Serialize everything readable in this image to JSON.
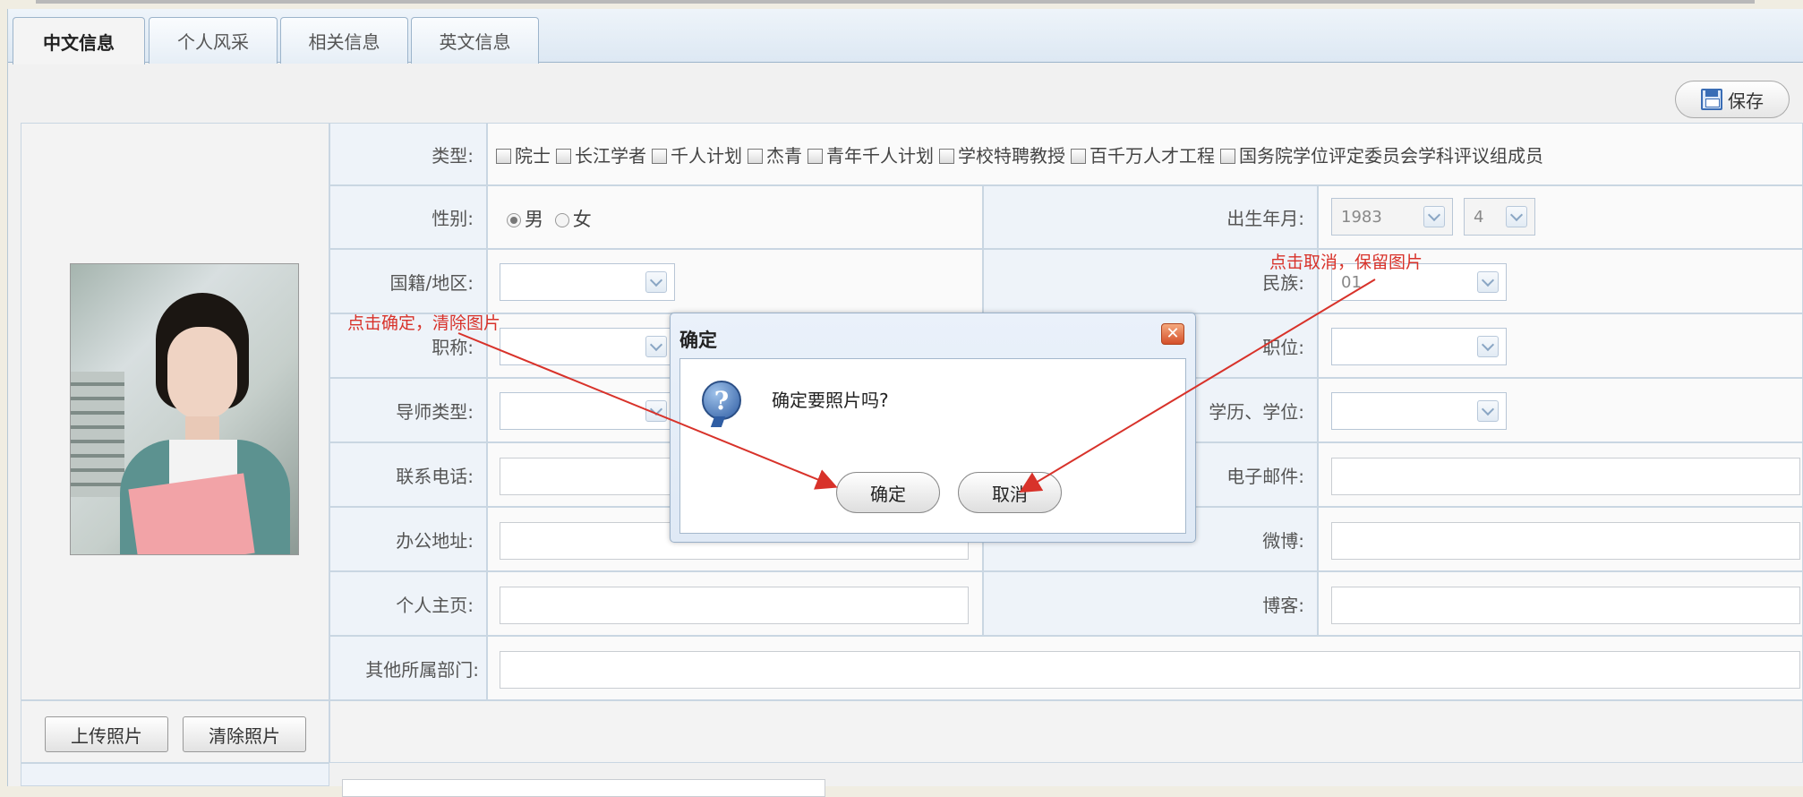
{
  "tabs": [
    {
      "label": "中文信息",
      "active": true
    },
    {
      "label": "个人风采",
      "active": false
    },
    {
      "label": "相关信息",
      "active": false
    },
    {
      "label": "英文信息",
      "active": false
    }
  ],
  "toolbar": {
    "save_label": "保存",
    "save_icon": "floppy-disk-icon"
  },
  "form": {
    "type_label": "类型:",
    "types": [
      "院士",
      "长江学者",
      "千人计划",
      "杰青",
      "青年千人计划",
      "学校特聘教授",
      "百千万人才工程",
      "国务院学位评定委员会学科评议组成员"
    ],
    "gender_label": "性别:",
    "gender_options": [
      "男",
      "女"
    ],
    "gender_selected": "男",
    "birth_label": "出生年月:",
    "birth_year": "1983",
    "birth_month": "4",
    "nationality_label": "国籍/地区:",
    "nationality_value": "",
    "ethnicity_label": "民族:",
    "ethnicity_value": "01",
    "title_label": "职称:",
    "title_value": "",
    "position_label": "职位:",
    "position_value": "",
    "mentor_label": "导师类型:",
    "mentor_value": "",
    "degree_label": "学历、学位:",
    "degree_value": "",
    "phone_label": "联系电话:",
    "email_label": "电子邮件:",
    "office_label": "办公地址:",
    "weibo_label": "微博:",
    "homepage_label": "个人主页:",
    "blog_label": "博客:",
    "other_dept_label": "其他所属部门:"
  },
  "photo_actions": {
    "upload": "上传照片",
    "clear": "清除照片"
  },
  "dialog": {
    "title": "确定",
    "message": "确定要照片吗?",
    "ok": "确定",
    "cancel": "取消",
    "icon": "question-icon"
  },
  "annotations": {
    "ok_note": "点击确定，清除图片",
    "cancel_note": "点击取消，保留图片"
  },
  "colors": {
    "annotation": "#d8322a",
    "tab_border": "#9cb4cb",
    "label_bg": "#eef3f9"
  }
}
